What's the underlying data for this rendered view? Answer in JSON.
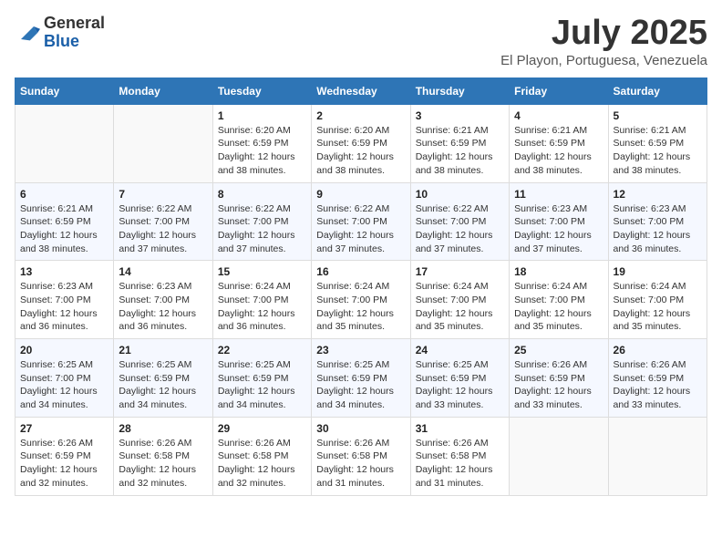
{
  "header": {
    "logo_general": "General",
    "logo_blue": "Blue",
    "title": "July 2025",
    "subtitle": "El Playon, Portuguesa, Venezuela"
  },
  "days_of_week": [
    "Sunday",
    "Monday",
    "Tuesday",
    "Wednesday",
    "Thursday",
    "Friday",
    "Saturday"
  ],
  "weeks": [
    [
      {
        "day": "",
        "info": ""
      },
      {
        "day": "",
        "info": ""
      },
      {
        "day": "1",
        "info": "Sunrise: 6:20 AM\nSunset: 6:59 PM\nDaylight: 12 hours and 38 minutes."
      },
      {
        "day": "2",
        "info": "Sunrise: 6:20 AM\nSunset: 6:59 PM\nDaylight: 12 hours and 38 minutes."
      },
      {
        "day": "3",
        "info": "Sunrise: 6:21 AM\nSunset: 6:59 PM\nDaylight: 12 hours and 38 minutes."
      },
      {
        "day": "4",
        "info": "Sunrise: 6:21 AM\nSunset: 6:59 PM\nDaylight: 12 hours and 38 minutes."
      },
      {
        "day": "5",
        "info": "Sunrise: 6:21 AM\nSunset: 6:59 PM\nDaylight: 12 hours and 38 minutes."
      }
    ],
    [
      {
        "day": "6",
        "info": "Sunrise: 6:21 AM\nSunset: 6:59 PM\nDaylight: 12 hours and 38 minutes."
      },
      {
        "day": "7",
        "info": "Sunrise: 6:22 AM\nSunset: 7:00 PM\nDaylight: 12 hours and 37 minutes."
      },
      {
        "day": "8",
        "info": "Sunrise: 6:22 AM\nSunset: 7:00 PM\nDaylight: 12 hours and 37 minutes."
      },
      {
        "day": "9",
        "info": "Sunrise: 6:22 AM\nSunset: 7:00 PM\nDaylight: 12 hours and 37 minutes."
      },
      {
        "day": "10",
        "info": "Sunrise: 6:22 AM\nSunset: 7:00 PM\nDaylight: 12 hours and 37 minutes."
      },
      {
        "day": "11",
        "info": "Sunrise: 6:23 AM\nSunset: 7:00 PM\nDaylight: 12 hours and 37 minutes."
      },
      {
        "day": "12",
        "info": "Sunrise: 6:23 AM\nSunset: 7:00 PM\nDaylight: 12 hours and 36 minutes."
      }
    ],
    [
      {
        "day": "13",
        "info": "Sunrise: 6:23 AM\nSunset: 7:00 PM\nDaylight: 12 hours and 36 minutes."
      },
      {
        "day": "14",
        "info": "Sunrise: 6:23 AM\nSunset: 7:00 PM\nDaylight: 12 hours and 36 minutes."
      },
      {
        "day": "15",
        "info": "Sunrise: 6:24 AM\nSunset: 7:00 PM\nDaylight: 12 hours and 36 minutes."
      },
      {
        "day": "16",
        "info": "Sunrise: 6:24 AM\nSunset: 7:00 PM\nDaylight: 12 hours and 35 minutes."
      },
      {
        "day": "17",
        "info": "Sunrise: 6:24 AM\nSunset: 7:00 PM\nDaylight: 12 hours and 35 minutes."
      },
      {
        "day": "18",
        "info": "Sunrise: 6:24 AM\nSunset: 7:00 PM\nDaylight: 12 hours and 35 minutes."
      },
      {
        "day": "19",
        "info": "Sunrise: 6:24 AM\nSunset: 7:00 PM\nDaylight: 12 hours and 35 minutes."
      }
    ],
    [
      {
        "day": "20",
        "info": "Sunrise: 6:25 AM\nSunset: 7:00 PM\nDaylight: 12 hours and 34 minutes."
      },
      {
        "day": "21",
        "info": "Sunrise: 6:25 AM\nSunset: 6:59 PM\nDaylight: 12 hours and 34 minutes."
      },
      {
        "day": "22",
        "info": "Sunrise: 6:25 AM\nSunset: 6:59 PM\nDaylight: 12 hours and 34 minutes."
      },
      {
        "day": "23",
        "info": "Sunrise: 6:25 AM\nSunset: 6:59 PM\nDaylight: 12 hours and 34 minutes."
      },
      {
        "day": "24",
        "info": "Sunrise: 6:25 AM\nSunset: 6:59 PM\nDaylight: 12 hours and 33 minutes."
      },
      {
        "day": "25",
        "info": "Sunrise: 6:26 AM\nSunset: 6:59 PM\nDaylight: 12 hours and 33 minutes."
      },
      {
        "day": "26",
        "info": "Sunrise: 6:26 AM\nSunset: 6:59 PM\nDaylight: 12 hours and 33 minutes."
      }
    ],
    [
      {
        "day": "27",
        "info": "Sunrise: 6:26 AM\nSunset: 6:59 PM\nDaylight: 12 hours and 32 minutes."
      },
      {
        "day": "28",
        "info": "Sunrise: 6:26 AM\nSunset: 6:58 PM\nDaylight: 12 hours and 32 minutes."
      },
      {
        "day": "29",
        "info": "Sunrise: 6:26 AM\nSunset: 6:58 PM\nDaylight: 12 hours and 32 minutes."
      },
      {
        "day": "30",
        "info": "Sunrise: 6:26 AM\nSunset: 6:58 PM\nDaylight: 12 hours and 31 minutes."
      },
      {
        "day": "31",
        "info": "Sunrise: 6:26 AM\nSunset: 6:58 PM\nDaylight: 12 hours and 31 minutes."
      },
      {
        "day": "",
        "info": ""
      },
      {
        "day": "",
        "info": ""
      }
    ]
  ]
}
